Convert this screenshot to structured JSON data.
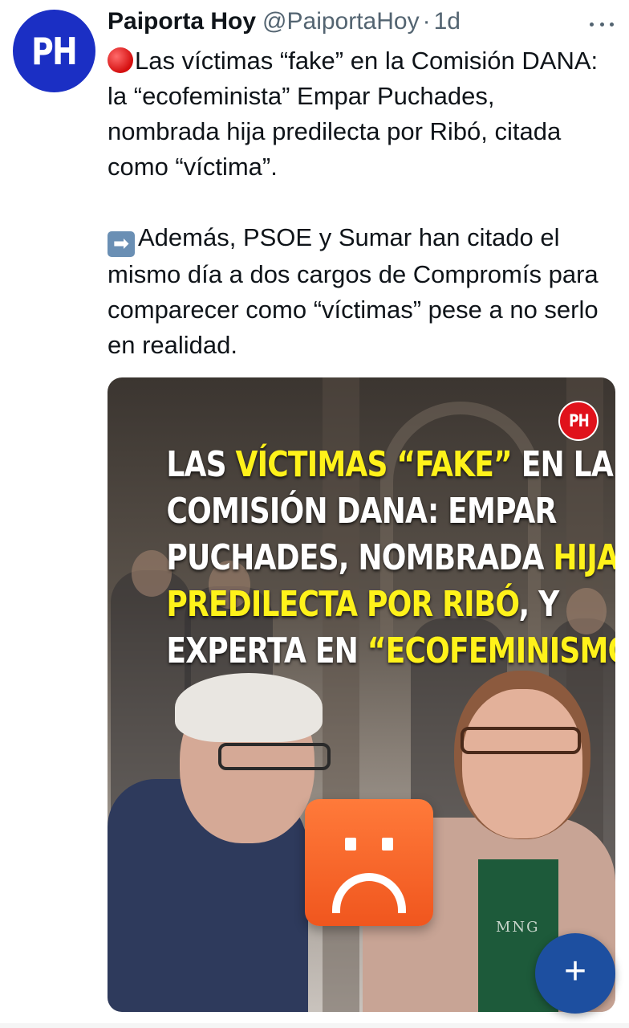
{
  "author": {
    "avatar_text": "PH",
    "display_name": "Paiporta Hoy",
    "handle": "@PaiportaHoy",
    "separator": "·",
    "time": "1d"
  },
  "tweet": {
    "paragraph_1": "Las víctimas “fake” en la Comisión DANA: la “ecofeminista” Empar Puchades, nombrada hija predilecta por Ribó, citada como “víctima”.",
    "paragraph_2": "Además, PSOE y Sumar han citado el mismo día a dos cargos de Compromís para comparecer como “víctimas” pese a no serlo en realidad.",
    "emoji_1": "red-circle",
    "emoji_2": "right-arrow"
  },
  "media": {
    "badge": "PH",
    "headline": {
      "l1_a": "LAS ",
      "l1_b": "VÍCTIMAS “FAKE”",
      "l1_c": " EN LA",
      "l2": "COMISIÓN DANA: EMPAR",
      "l3_a": "PUCHADES, NOMBRADA ",
      "l3_b": "HIJA",
      "l4_a": "PREDILECTA POR RIBÓ",
      "l4_b": ", Y",
      "l5_a": "EXPERTA EN ",
      "l5_b": "“ECOFEMINISMO”"
    },
    "shirt_text": "MNG",
    "sticker": "sad-face"
  },
  "compose_button": {
    "icon": "plus-icon",
    "glyph": "+"
  },
  "colors": {
    "avatar": "#1b2fc4",
    "badge": "#e0121b",
    "headline_highlight": "#fff21a",
    "sticker": "#f0561e",
    "fab": "#1d4fa0",
    "muted_text": "#536471"
  }
}
